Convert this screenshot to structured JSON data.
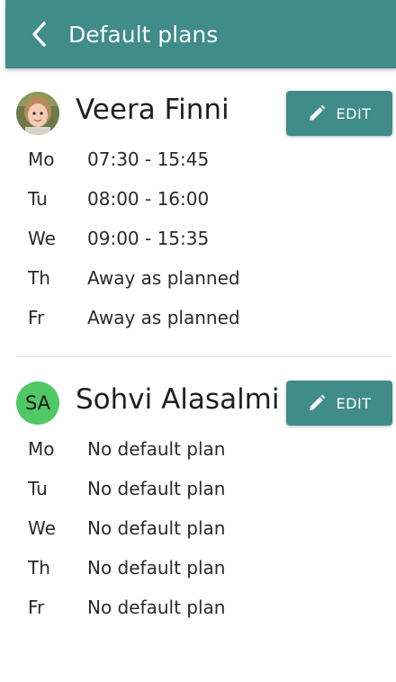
{
  "header": {
    "title": "Default plans",
    "background_color": "#3f8c8a",
    "back_icon": "chevron-left-icon"
  },
  "children": [
    {
      "name": "Veera Finni",
      "avatar": "photo",
      "edit_label": "EDIT",
      "edit_icon": "pencil-icon",
      "days": [
        {
          "day": "Mo",
          "plan": "07:30 - 15:45"
        },
        {
          "day": "Tu",
          "plan": "08:00 - 16:00"
        },
        {
          "day": "We",
          "plan": "09:00 - 15:35"
        },
        {
          "day": "Th",
          "plan": "Away as planned"
        },
        {
          "day": "Fr",
          "plan": "Away as planned"
        }
      ]
    },
    {
      "name": "Sohvi Alasalmi",
      "avatar": "initials",
      "initials": "SA",
      "avatar_color": "#4fc865",
      "edit_label": "EDIT",
      "edit_icon": "pencil-icon",
      "days": [
        {
          "day": "Mo",
          "plan": "No default plan"
        },
        {
          "day": "Tu",
          "plan": "No default plan"
        },
        {
          "day": "We",
          "plan": "No default plan"
        },
        {
          "day": "Th",
          "plan": "No default plan"
        },
        {
          "day": "Fr",
          "plan": "No default plan"
        }
      ]
    }
  ]
}
